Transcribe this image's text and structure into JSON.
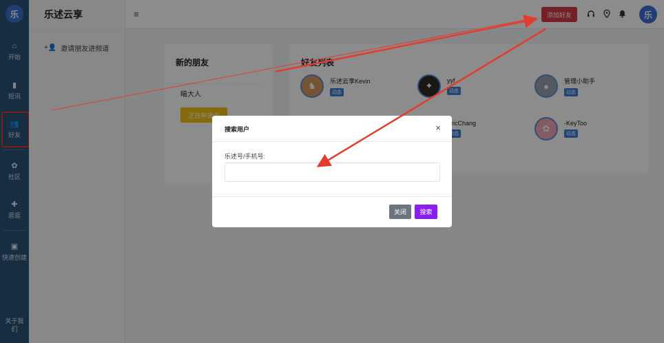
{
  "rail": {
    "logo": "乐",
    "items": [
      {
        "label": "开始",
        "icon": "home-icon",
        "glyph": "⌂"
      },
      {
        "label": "短讯",
        "icon": "message-icon",
        "glyph": "▮"
      },
      {
        "label": "好友",
        "icon": "friends-icon",
        "glyph": "👥"
      },
      {
        "label": "社区",
        "icon": "community-icon",
        "glyph": "✿"
      },
      {
        "label": "逛逛",
        "icon": "browse-icon",
        "glyph": "✚"
      },
      {
        "label": "快速创建",
        "icon": "create-icon",
        "glyph": "▣"
      }
    ],
    "bottom_label": "关于我们"
  },
  "sidebar": {
    "title": "乐述云享",
    "invite_label": "邀请朋友进频道"
  },
  "topbar": {
    "menu_glyph": "≡",
    "add_friend_label": "添加好友",
    "avatar_glyph": "乐"
  },
  "new_friends": {
    "title": "新的朋友",
    "name": "瞄大人",
    "status_label": "正在申请中"
  },
  "friend_list": {
    "title": "好友列表",
    "badge": "动态",
    "friends": [
      {
        "name": "乐述云享Kevin"
      },
      {
        "name": "yyf"
      },
      {
        "name": "管理小助手"
      },
      {
        "name": "EricChang"
      },
      {
        "name": "-KeyToo"
      }
    ]
  },
  "modal": {
    "title": "搜索用户",
    "close_glyph": "×",
    "field_label": "乐述号/手机号:",
    "field_value": "",
    "close_label": "关闭",
    "search_label": "搜索"
  },
  "colors": {
    "rail_bg": "#2b5578",
    "add_friend": "#d63a4a",
    "applying": "#f3c214",
    "badge": "#3f7ed8",
    "search_btn": "#8a1ff0",
    "close_btn": "#6c757d",
    "annotation": "#e33b2e"
  }
}
